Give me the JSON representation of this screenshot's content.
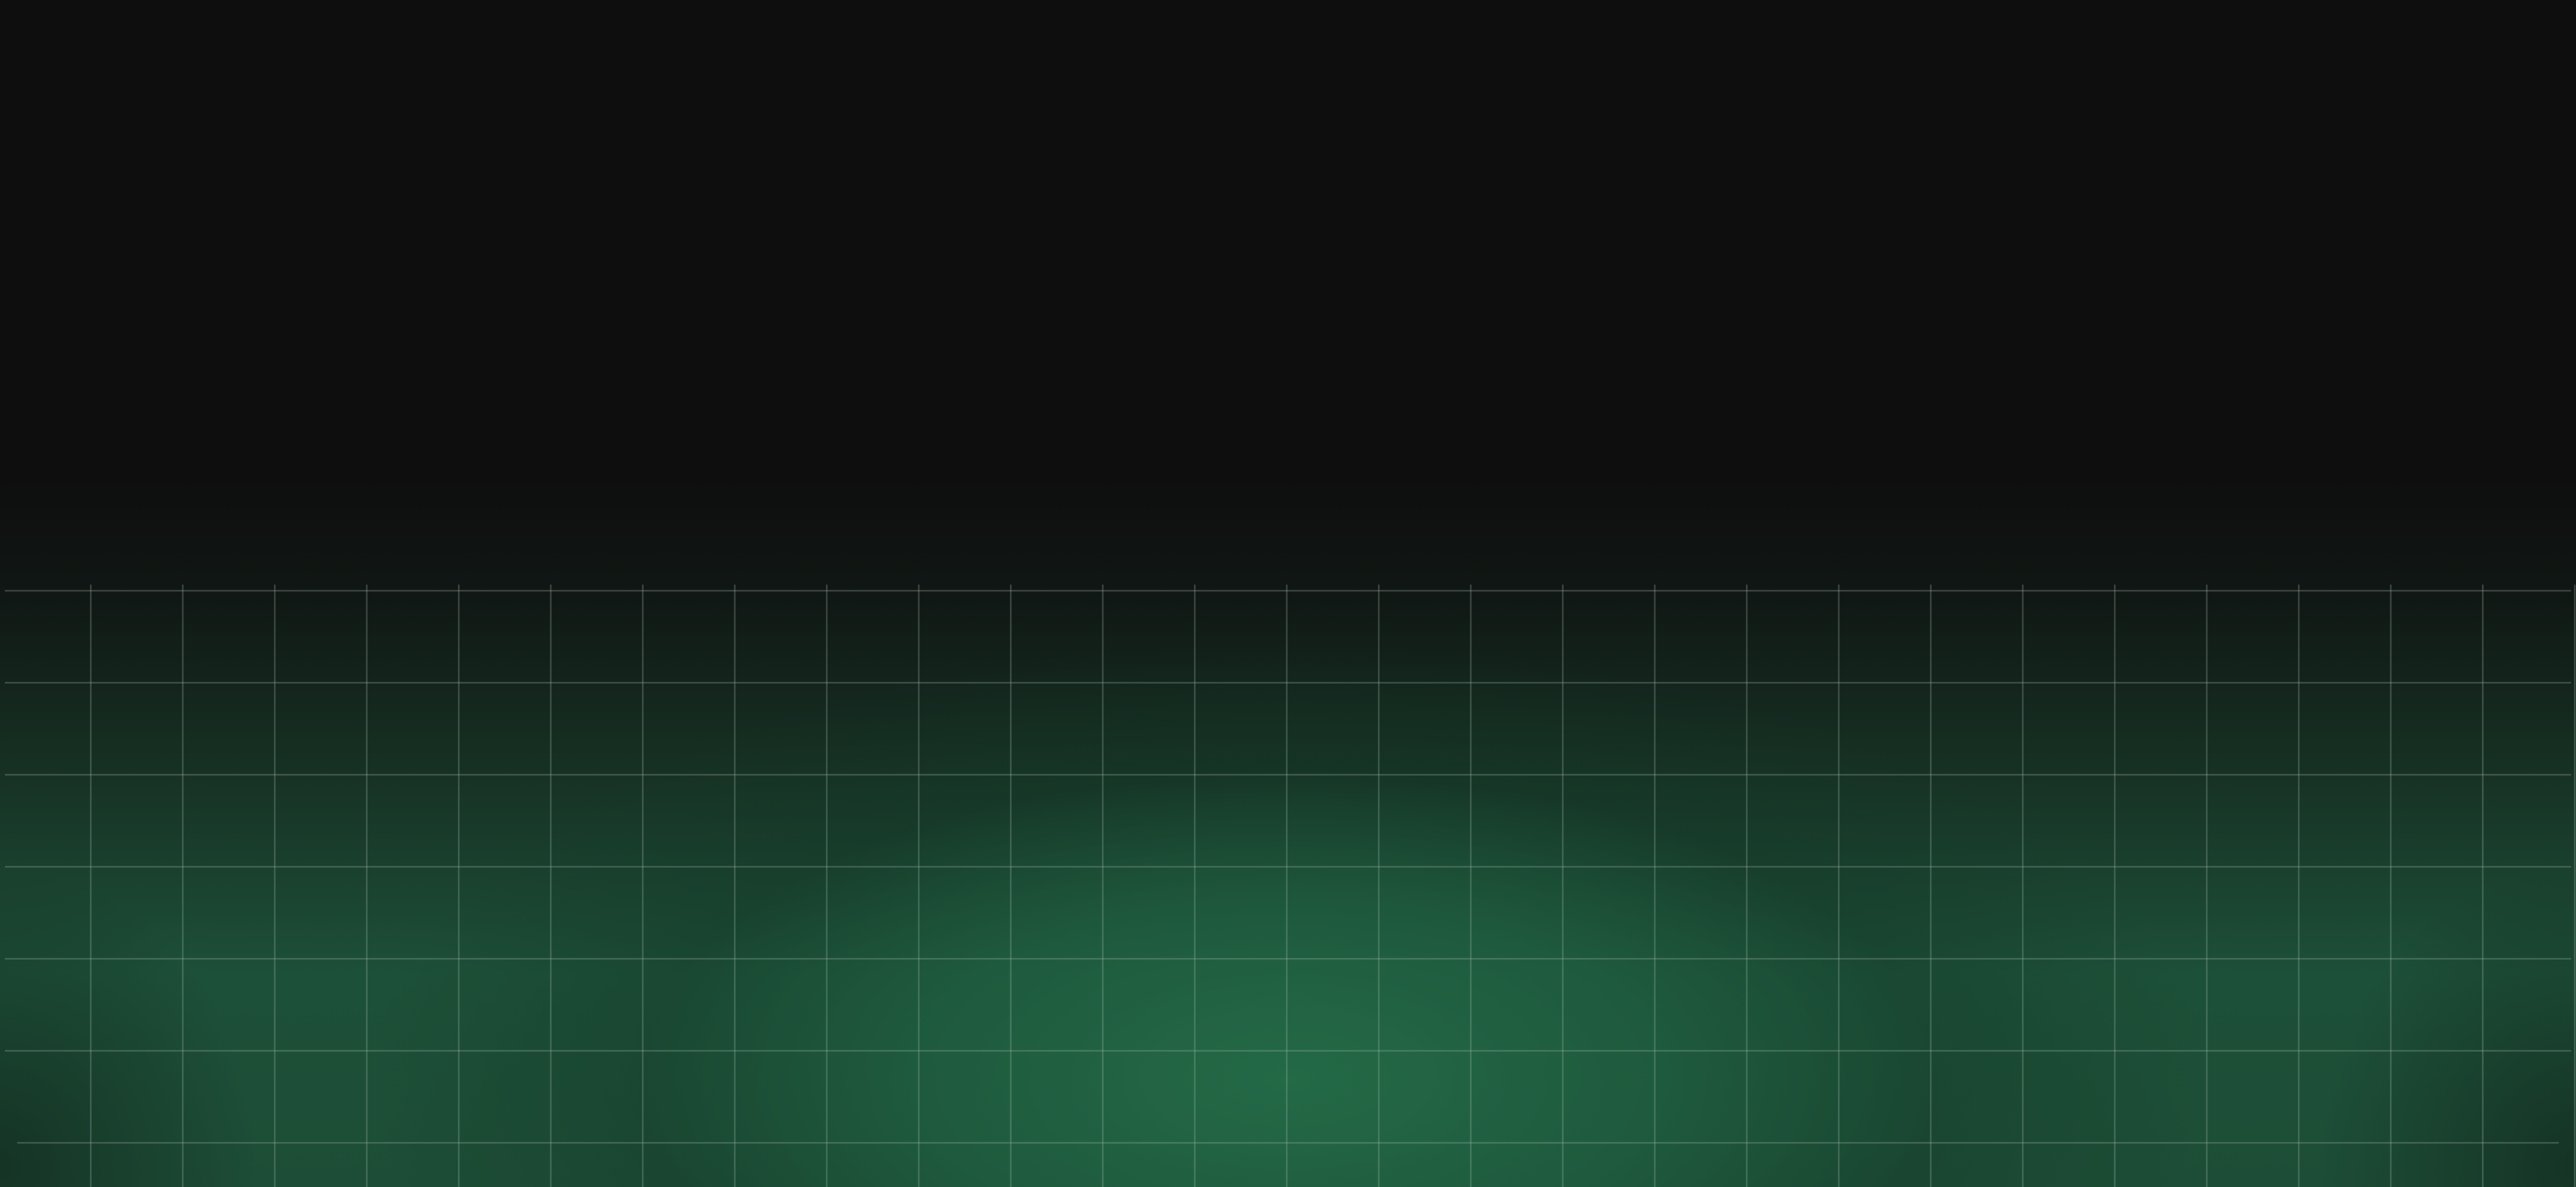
{
  "background": {
    "base_color": "#0e0e0e",
    "glow_color": "#1d5a3d",
    "grid_line_color": "#8fa39a"
  },
  "grid": {
    "horizontal_lines": 7,
    "vertical_lines": 28
  }
}
